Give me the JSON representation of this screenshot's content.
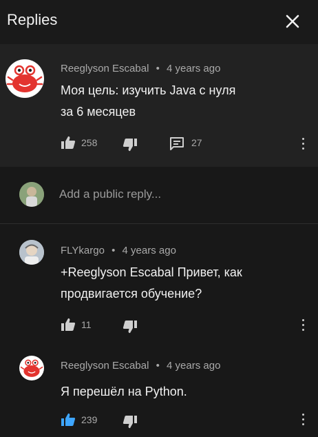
{
  "header": {
    "title": "Replies",
    "close_icon": "close-icon"
  },
  "comment": {
    "author": "Reeglyson Escabal",
    "age": "4 years ago",
    "text_line1": "Моя цель: изучить Java с нуля",
    "text_line2": "за 6 месяцев",
    "likes": "258",
    "replies": "27"
  },
  "reply_box": {
    "placeholder": "Add a public reply..."
  },
  "replies": [
    {
      "author": "FLYkargo",
      "age": "4 years ago",
      "mention": "+Reeglyson Escabal",
      "text_rest": " Привет, как",
      "text_line2": "продвигается обучение?",
      "likes": "11"
    },
    {
      "author": "Reeglyson Escabal",
      "age": "4 years ago",
      "text": "Я перешёл на Python.",
      "likes": "239"
    }
  ],
  "separator": "•",
  "colors": {
    "background": "#181818",
    "card": "#222222",
    "text": "#f1f1f1",
    "muted": "#aaaaaa",
    "liked_blue": "#3ea6ff"
  }
}
